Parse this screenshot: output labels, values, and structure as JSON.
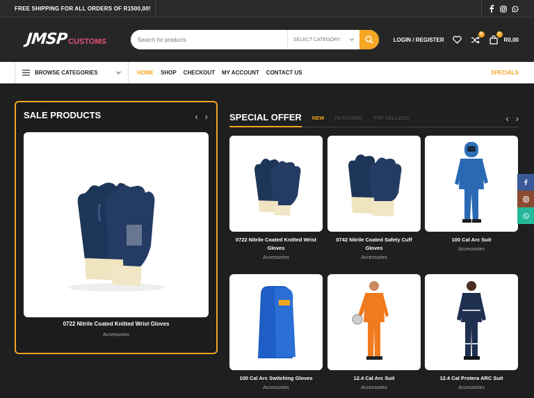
{
  "topbar": {
    "shipping": "FREE SHIPPING FOR ALL ORDERS OF R1500,00!"
  },
  "logo": {
    "main": "JMSP",
    "sub": "CUSTOMS"
  },
  "search": {
    "placeholder": "Search for products",
    "category": "SELECT CATEGORY"
  },
  "header": {
    "login": "LOGIN / REGISTER",
    "compare_count": "0",
    "cart_count": "0",
    "cart_total": "R0,00"
  },
  "nav": {
    "browse": "BROWSE CATEGORIES",
    "items": [
      "HOME",
      "SHOP",
      "CHECKOUT",
      "MY ACCOUNT",
      "CONTACT US"
    ],
    "specials": "SPECIALS"
  },
  "sale": {
    "title": "SALE PRODUCTS",
    "product": {
      "name": "0722 Nitrile Coated Knitted Wrist Gloves",
      "category": "Accessories"
    }
  },
  "offer": {
    "title": "SPECIAL OFFER",
    "tabs": [
      "NEW",
      "FEATURED",
      "TOP SELLERS"
    ],
    "products": [
      {
        "name": "0722 Nitrile Coated Knitted Wrist Gloves",
        "category": "Accessories"
      },
      {
        "name": "0742 Nitrile Coated Safety Cuff Gloves",
        "category": "Accessories"
      },
      {
        "name": "100 Cal Arc Suit",
        "category": "Accessories"
      },
      {
        "name": "100 Cal Arc Switching Gloves",
        "category": "Accessories"
      },
      {
        "name": "12.4 Cal Arc Suit",
        "category": "Accessories"
      },
      {
        "name": "12.4 Cal Protera ARC Suit",
        "category": "Accessories"
      }
    ]
  },
  "colors": {
    "accent": "#f5a623",
    "logo_pink": "#e6557a",
    "facebook": "#3b5998",
    "instagram": "#8a4a2f",
    "whatsapp": "#25b89a"
  }
}
